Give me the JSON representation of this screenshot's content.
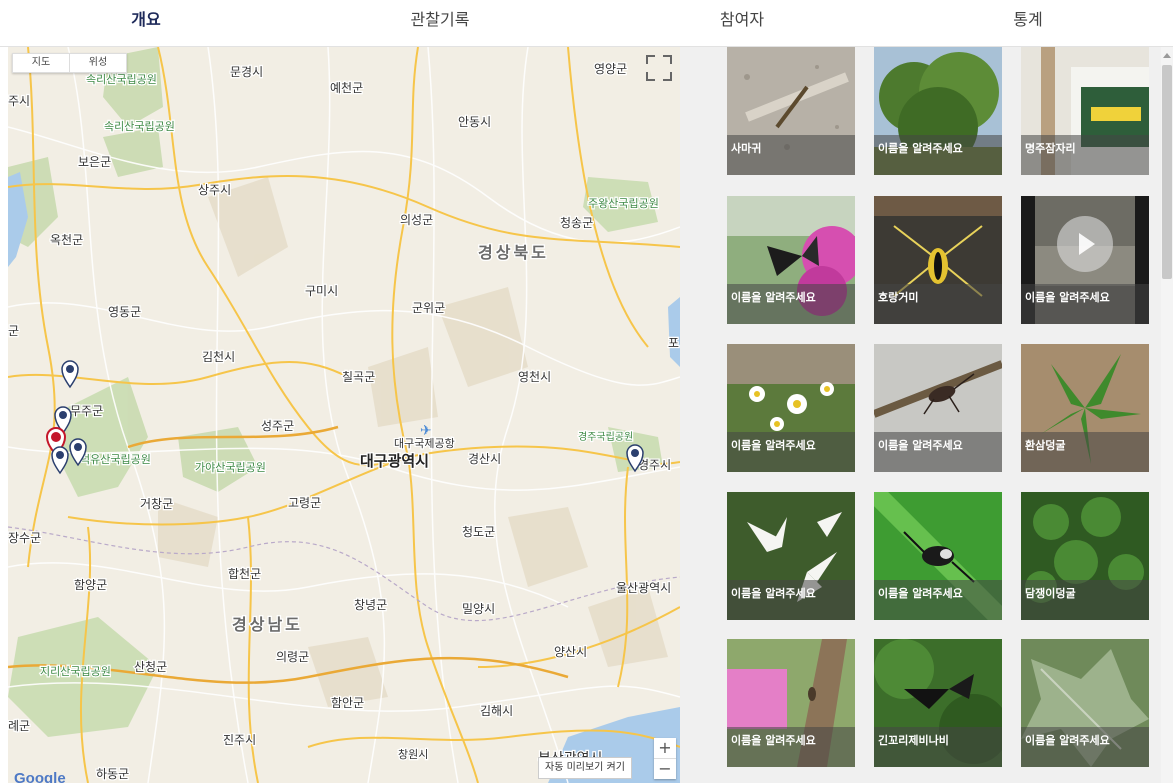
{
  "tabs": [
    {
      "label": "개요",
      "active": true
    },
    {
      "label": "관찰기록",
      "active": false
    },
    {
      "label": "참여자",
      "active": false
    },
    {
      "label": "통계",
      "active": false
    }
  ],
  "map": {
    "type_buttons": [
      "지도",
      "위성"
    ],
    "autopreview_label": "자동 미리보기 켜기",
    "zoom_in": "+",
    "zoom_out": "−",
    "logo": "Google",
    "labels": [
      {
        "t": "속리산국립공원",
        "c": "green"
      },
      {
        "t": "속리산국립공원",
        "c": "green"
      },
      {
        "t": "주시",
        "c": "dark"
      },
      {
        "t": "문경시",
        "c": "dark"
      },
      {
        "t": "예천군",
        "c": "dark"
      },
      {
        "t": "영양군",
        "c": "dark"
      },
      {
        "t": "안동시",
        "c": "dark"
      },
      {
        "t": "보은군",
        "c": "dark"
      },
      {
        "t": "상주시",
        "c": "dark"
      },
      {
        "t": "주왕산국립공원",
        "c": "green"
      },
      {
        "t": "의성군",
        "c": "dark"
      },
      {
        "t": "청송군",
        "c": "dark"
      },
      {
        "t": "옥천군",
        "c": "dark"
      },
      {
        "t": "경상북도",
        "c": "region"
      },
      {
        "t": "구미시",
        "c": "dark"
      },
      {
        "t": "영동군",
        "c": "dark"
      },
      {
        "t": "군위군",
        "c": "dark"
      },
      {
        "t": "군",
        "c": "dark"
      },
      {
        "t": "포",
        "c": "dark"
      },
      {
        "t": "김천시",
        "c": "dark"
      },
      {
        "t": "칠곡군",
        "c": "dark"
      },
      {
        "t": "영천시",
        "c": "dark"
      },
      {
        "t": "무주군",
        "c": "dark"
      },
      {
        "t": "성주군",
        "c": "dark"
      },
      {
        "t": "대구국제공항",
        "c": "dark"
      },
      {
        "t": "경주국립공원",
        "c": "green"
      },
      {
        "t": "덕유산국립공원",
        "c": "green"
      },
      {
        "t": "가야산국립공원",
        "c": "green"
      },
      {
        "t": "대구광역시",
        "c": "city"
      },
      {
        "t": "경산시",
        "c": "dark"
      },
      {
        "t": "경주시",
        "c": "dark"
      },
      {
        "t": "거창군",
        "c": "dark"
      },
      {
        "t": "고령군",
        "c": "dark"
      },
      {
        "t": "청도군",
        "c": "dark"
      },
      {
        "t": "장수군",
        "c": "dark"
      },
      {
        "t": "합천군",
        "c": "dark"
      },
      {
        "t": "함양군",
        "c": "dark"
      },
      {
        "t": "울산광역시",
        "c": "dark"
      },
      {
        "t": "창녕군",
        "c": "dark"
      },
      {
        "t": "밀양시",
        "c": "dark"
      },
      {
        "t": "경상남도",
        "c": "region"
      },
      {
        "t": "의령군",
        "c": "dark"
      },
      {
        "t": "양산시",
        "c": "dark"
      },
      {
        "t": "지리산국립공원",
        "c": "green"
      },
      {
        "t": "산청군",
        "c": "dark"
      },
      {
        "t": "함안군",
        "c": "dark"
      },
      {
        "t": "김해시",
        "c": "dark"
      },
      {
        "t": "진주시",
        "c": "dark"
      },
      {
        "t": "창원시",
        "c": "dark"
      },
      {
        "t": "하동군",
        "c": "dark"
      },
      {
        "t": "례군",
        "c": "dark"
      },
      {
        "t": "부산광역시",
        "c": "dark"
      }
    ],
    "marker_color_main": "#2b3f6e",
    "marker_color_selected": "#c4162a"
  },
  "gallery": [
    {
      "label": "사마귀",
      "photo": "mantis"
    },
    {
      "label": "이름을 알려주세요",
      "photo": "tree"
    },
    {
      "label": "명주잠자리",
      "photo": "sign"
    },
    {
      "label": "이름을 알려주세요",
      "photo": "butterfly"
    },
    {
      "label": "호랑거미",
      "photo": "spider"
    },
    {
      "label": "이름을 알려주세요",
      "photo": "video"
    },
    {
      "label": "이름을 알려주세요",
      "photo": "daisy"
    },
    {
      "label": "이름을 알려주세요",
      "photo": "bug"
    },
    {
      "label": "환삼덩굴",
      "photo": "leaf"
    },
    {
      "label": "이름을 알려주세요",
      "photo": "lily"
    },
    {
      "label": "이름을 알려주세요",
      "photo": "jumper"
    },
    {
      "label": "담쟁이덩굴",
      "photo": "ivy"
    },
    {
      "label": "이름을 알려주세요",
      "photo": "pole"
    },
    {
      "label": "긴꼬리제비나비",
      "photo": "swallowtail"
    },
    {
      "label": "이름을 알려주세요",
      "photo": "oakleaf"
    }
  ]
}
